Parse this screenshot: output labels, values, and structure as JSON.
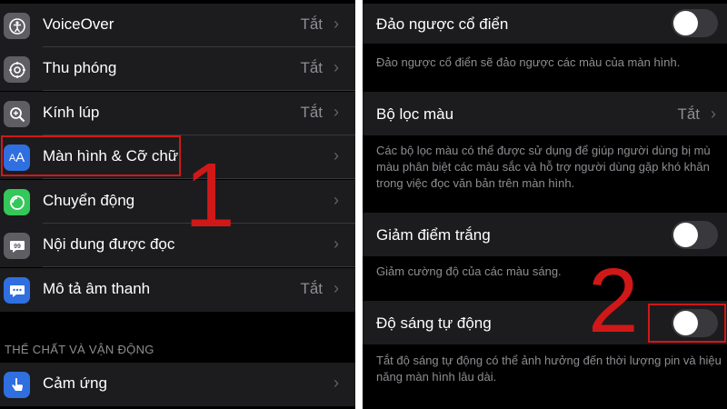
{
  "left": {
    "items": [
      {
        "label": "VoiceOver",
        "value": "Tắt",
        "icon": "voiceover-icon",
        "color": "#5e5e63"
      },
      {
        "label": "Thu phóng",
        "value": "Tắt",
        "icon": "zoom-icon",
        "color": "#5e5e63"
      },
      {
        "label": "Kính lúp",
        "value": "Tắt",
        "icon": "magnifier-icon",
        "color": "#5e5e63"
      },
      {
        "label": "Màn hình & Cỡ chữ",
        "value": "",
        "icon": "display-text-size-icon",
        "color": "#2f6fe0"
      },
      {
        "label": "Chuyển động",
        "value": "",
        "icon": "motion-icon",
        "color": "#34c759"
      },
      {
        "label": "Nội dung được đọc",
        "value": "",
        "icon": "spoken-content-icon",
        "color": "#5e5e63"
      },
      {
        "label": "Mô tả âm thanh",
        "value": "Tắt",
        "icon": "audio-descriptions-icon",
        "color": "#2f6fe0"
      }
    ],
    "section_header": "THỂ CHẤT VÀ VẬN ĐỘNG",
    "section_items": [
      {
        "label": "Cảm ứng",
        "value": "",
        "icon": "touch-icon",
        "color": "#2f6fe0"
      }
    ],
    "annotation": "1",
    "chevron": "›"
  },
  "right": {
    "classic_invert": {
      "label": "Đảo ngược cổ điển",
      "footer": "Đảo ngược cổ điển sẽ đảo ngược các màu của màn hình.",
      "on": false
    },
    "color_filters": {
      "label": "Bộ lọc màu",
      "value": "Tắt",
      "footer": "Các bộ lọc màu có thể được sử dụng để giúp người dùng bị mù màu phân biệt các màu sắc và hỗ trợ người dùng gặp khó khăn trong việc đọc văn bản trên màn hình."
    },
    "reduce_white_point": {
      "label": "Giảm điểm trắng",
      "footer": "Giảm cường độ của các màu sáng.",
      "on": false
    },
    "auto_brightness": {
      "label": "Độ sáng tự động",
      "footer": "Tắt độ sáng tự động có thể ảnh hưởng đến thời lượng pin và hiệu năng màn hình lâu dài.",
      "on": false
    },
    "annotation": "2",
    "chevron": "›"
  },
  "colors": {
    "highlight": "#d01818",
    "row_bg": "#1c1c1e",
    "secondary_text": "#8e8e93"
  }
}
